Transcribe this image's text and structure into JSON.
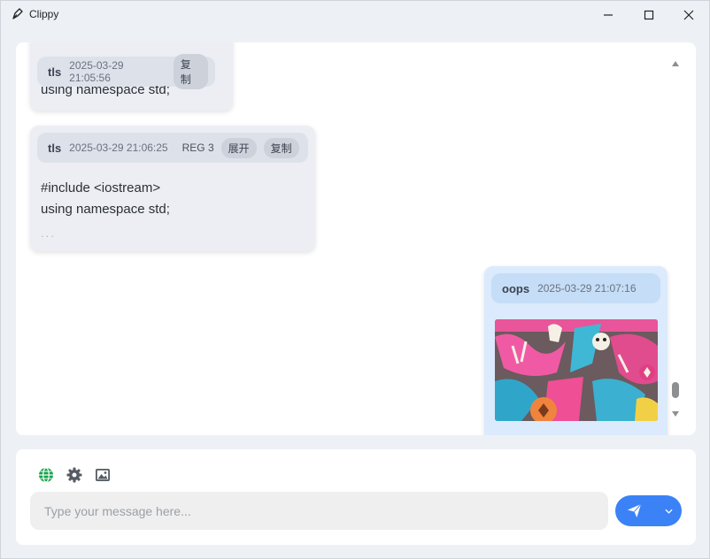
{
  "window": {
    "title": "Clippy",
    "icon": "pen-nib-icon"
  },
  "messages": [
    {
      "author": "tls",
      "timestamp": "2025-03-29 21:05:56",
      "copy_label": "复制",
      "text": "using namespace std;"
    },
    {
      "author": "tls",
      "timestamp": "2025-03-29 21:06:25",
      "reg_label": "REG 3",
      "expand_label": "展开",
      "copy_label": "复制",
      "text": "#include <iostream>\nusing namespace std;",
      "ellipsis": "..."
    },
    {
      "author": "oops",
      "timestamp": "2025-03-29 21:07:16",
      "attachment": "graffiti-image"
    }
  ],
  "toolbar": {
    "icons": [
      "globe-icon",
      "gear-icon",
      "image-icon"
    ]
  },
  "input": {
    "placeholder": "Type your message here...",
    "value": ""
  },
  "send": {
    "icon": "paper-plane-icon",
    "menu_icon": "chevron-down-icon"
  },
  "colors": {
    "accent": "#3b82f6",
    "own_bubble": "#dbeafc",
    "other_bubble": "#eceef3",
    "globe": "#16a34a"
  }
}
